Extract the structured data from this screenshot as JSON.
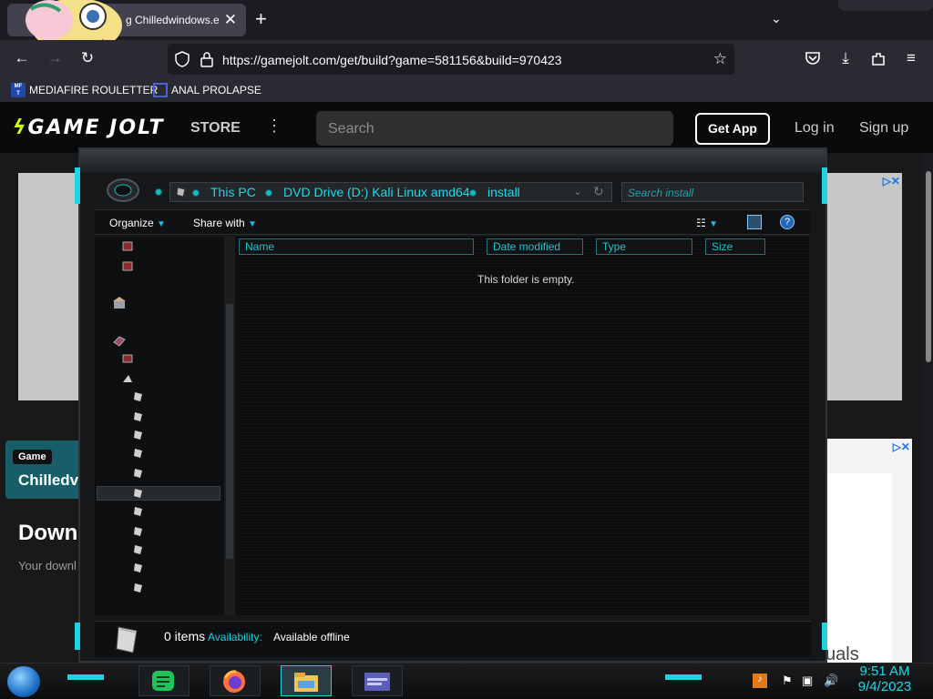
{
  "browser": {
    "tab_title": "g Chilledwindows.e",
    "url": "https://gamejolt.com/get/build?game=581156&build=970423",
    "bookmarks": [
      {
        "label": "MEDIAFIRE ROULETTER",
        "icon": "mediafire-icon"
      },
      {
        "label": "ANAL PROLAPSE",
        "icon": "bookmark-icon"
      }
    ]
  },
  "gamejolt": {
    "logo": "GAME JOLT",
    "store": "STORE",
    "search_placeholder": "Search",
    "get_app": "Get App",
    "login": "Log in",
    "signup": "Sign up",
    "card_tag": "Game",
    "card_name": "Chilledv",
    "heading": "Down",
    "subtext": "Your downl",
    "ad_fragment": "uals"
  },
  "explorer": {
    "breadcrumb": [
      "This PC",
      "DVD Drive (D:) Kali Linux amd64",
      "install"
    ],
    "search_placeholder": "Search install",
    "toolbar": {
      "organize": "Organize",
      "share": "Share with"
    },
    "columns": [
      "Name",
      "Date modified",
      "Type",
      "Size"
    ],
    "empty_message": "This folder is empty.",
    "details": {
      "count": "0 items",
      "availability_label": "Availability:",
      "availability_value": "Available offline"
    }
  },
  "taskbar": {
    "time": "9:51 AM",
    "date": "9/4/2023",
    "apps": [
      "notes-app-icon",
      "firefox-icon",
      "file-explorer-icon",
      "window-app-icon"
    ]
  }
}
